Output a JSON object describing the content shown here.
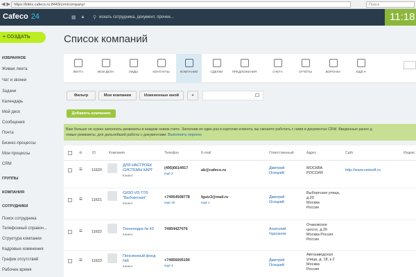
{
  "browser": {
    "url": "https://bitrix.cafeco.ru:8443/crm/company/",
    "search_placeholder": "Поиск"
  },
  "topbar": {
    "logo_main": "Cafeco",
    "logo_num": "24",
    "search_placeholder": "искать сотрудника, документ, прочее...",
    "time": "11:18"
  },
  "sidebar": {
    "create_button": "СОЗДАТЬ",
    "favorites_header": "ИЗБРАННОЕ",
    "items": [
      "Живая лента",
      "Чат и звонки",
      "Задачи",
      "Календарь",
      "Мой диск",
      "Сообщения",
      "Почта",
      "Бизнес-процессы",
      "Мои процессы",
      "CRM"
    ],
    "groups_header": "ГРУППЫ",
    "company_header": "КОМПАНИЯ",
    "employees_header": "СОТРУДНИКИ",
    "employee_items": [
      "Поиск сотрудника",
      "Телефонный справоч...",
      "Структура компании",
      "Кадровые изменения",
      "График отсутствий",
      "Рабочее время"
    ]
  },
  "page": {
    "title": "Список компаний"
  },
  "toolbar": {
    "items": [
      {
        "label": "ЛЕНТА"
      },
      {
        "label": "МОИ ДЕЛА"
      },
      {
        "label": "ЛИДЫ"
      },
      {
        "label": "КОНТАКТЫ"
      },
      {
        "label": "КОМПАНИИ"
      },
      {
        "label": "СДЕЛКИ"
      },
      {
        "label": "ПРЕДЛОЖЕНИЯ"
      },
      {
        "label": "СЧЕТА"
      },
      {
        "label": "ОТЧЁТЫ"
      },
      {
        "label": "ВОРОНКА"
      },
      {
        "label": "ЕЩЁ ▾"
      }
    ],
    "active": "КОМПАНИИ"
  },
  "filters": {
    "filter_label": "Фильтр",
    "my_companies": "Мои компании",
    "changed_by_me": "Измененные мной",
    "plus": "+"
  },
  "add_company_button": "Добавить компанию",
  "notice": {
    "line1": "Вам больше не нужно заполнять реквизиты в каждом новом счете. Заполнив их один раз в карточке клиента, вы сможете работать с ними в документах CRM. Введенные ранее д",
    "line2": "новые реквизиты, для дальнейшей работы с документами.",
    "link": "Выполнить перенос"
  },
  "table": {
    "columns": {
      "id": "ID",
      "company": "Компания",
      "phone": "Телефон",
      "email": "E-mail",
      "responsible": "Ответственный",
      "address": "Адрес",
      "site": "Сайт",
      "inn": "Индекс"
    },
    "rows": [
      {
        "id": "11620",
        "name_l1": "ДЛЯ НАСТРОЕК",
        "name_l2": "СИСТЕМЫ КАРТ",
        "type": "Клиент",
        "phone": "(495)6614917",
        "phone_more": "ещё 2",
        "email": "ab@cafeco.ru",
        "resp_l1": "Дмитрий",
        "resp_l2": "Осецкий",
        "addr": [
          "МОСКВА",
          "РОССИЯ"
        ],
        "site": "http://www.smtsoft.ru"
      },
      {
        "id": "11621",
        "name_l1": "СИЗО ИЗ 77/5",
        "name_l2": "\"Выборгская\"",
        "type": "Клиент",
        "phone": "+74954508778",
        "phone_more": "ещё 15",
        "email": "fguiz3@mail.ru",
        "email_more": "ещё 1",
        "resp_l1": "Дмитрий",
        "resp_l2": "Осецкий",
        "addr": [
          "Выборгская улица,",
          "д.20",
          "Москва",
          "Россия"
        ],
        "site": ""
      },
      {
        "id": "11622",
        "name_l1": "Техоплодка № 43",
        "name_l2": "",
        "type": "Клиент",
        "phone": "74954427076",
        "phone_more": "",
        "email": "",
        "resp_l1": "Анатолий",
        "resp_l2": "Чурсанов",
        "addr": [
          "Очаковское",
          "шоссе, д.26",
          "Москва Россия",
          "Россия"
        ],
        "site": ""
      },
      {
        "id": "11623",
        "name_l1": "Пенсионный фонд",
        "name_l2": "№6",
        "type": "Клиент",
        "phone": "+74956005190",
        "phone_more": "ещё 4",
        "email": "",
        "resp_l1": "Дмитрий",
        "resp_l2": "Осецкий",
        "addr": [
          "Автозаводская",
          "улица, д. 18, к 2",
          "Москва",
          "Россия"
        ],
        "site": ""
      }
    ]
  },
  "colors": {
    "topbar": "#2a3c4b",
    "clock": "#8cb63c",
    "create": "#bbed21",
    "notice": "#c6df92",
    "link": "#2067b0"
  }
}
